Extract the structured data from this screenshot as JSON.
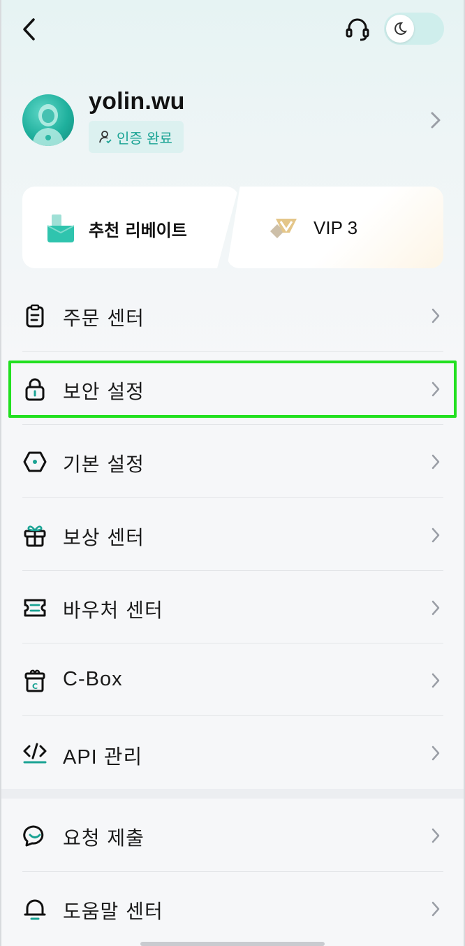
{
  "user": {
    "username": "yolin.wu",
    "verify_label": "인증 완료"
  },
  "cards": {
    "rebate_label": "추천 리베이트",
    "vip_label": "VIP 3"
  },
  "menu": [
    {
      "label": "주문 센터",
      "icon": "clipboard-icon"
    },
    {
      "label": "보안 설정",
      "icon": "lock-icon"
    },
    {
      "label": "기본 설정",
      "icon": "hexagon-settings-icon"
    },
    {
      "label": "보상 센터",
      "icon": "gift-icon"
    },
    {
      "label": "바우처 센터",
      "icon": "ticket-icon"
    },
    {
      "label": "C-Box",
      "icon": "cbox-icon"
    },
    {
      "label": "API 관리",
      "icon": "code-icon"
    },
    {
      "label": "요청 제출",
      "icon": "feedback-icon"
    },
    {
      "label": "도움말 센터",
      "icon": "bell-icon"
    }
  ],
  "colors": {
    "accent": "#1aa394",
    "highlight": "#22e020",
    "vip_gold": "#d9b26a"
  }
}
